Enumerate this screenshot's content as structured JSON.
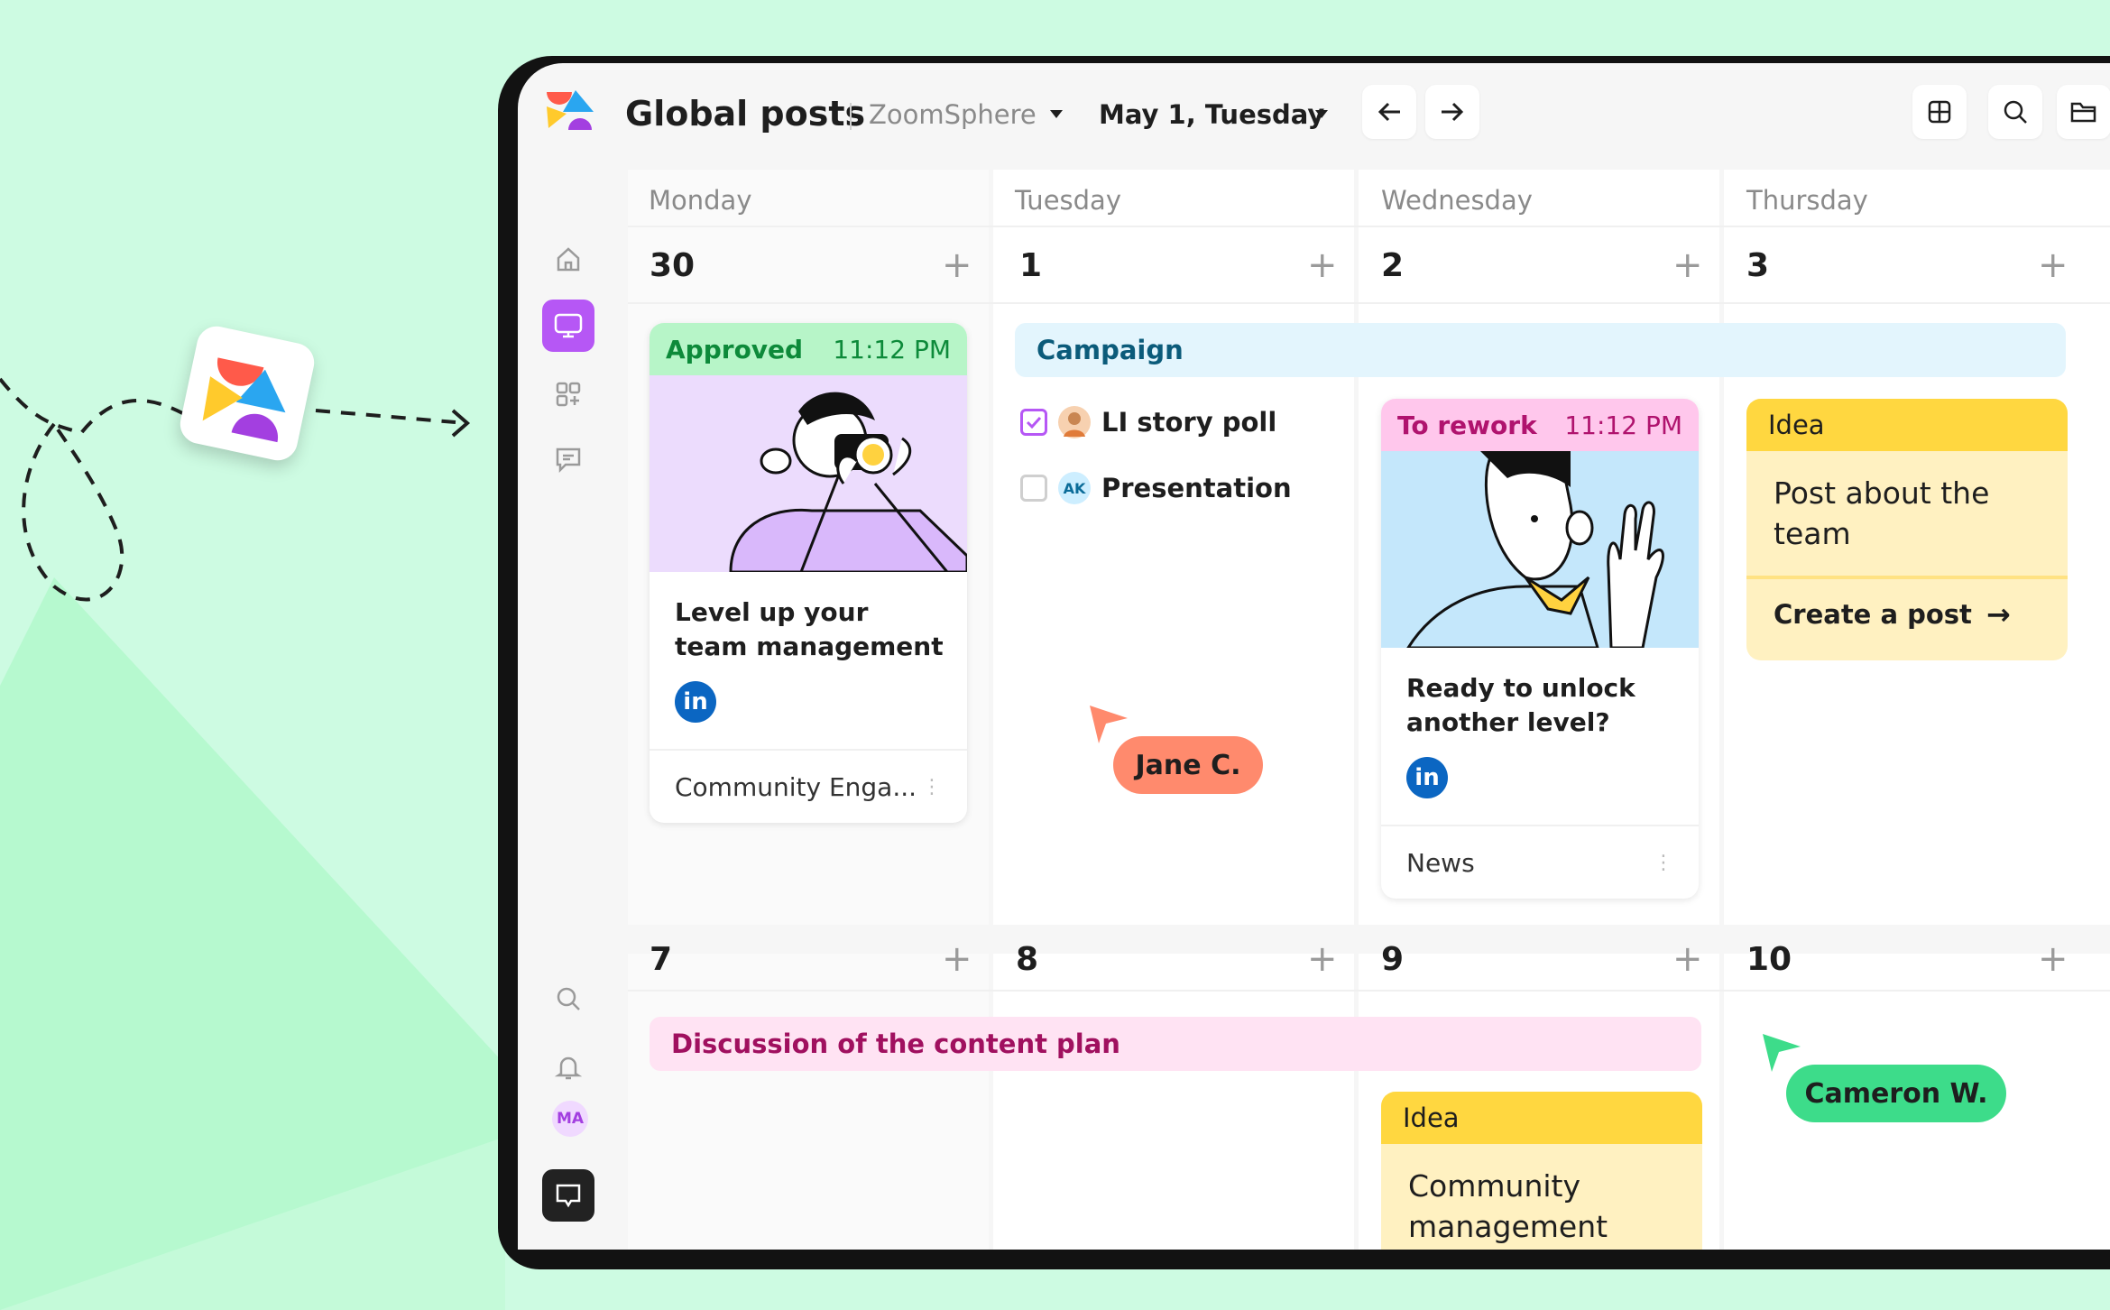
{
  "header": {
    "title": "Global posts",
    "workspace": "ZoomSphere",
    "date": "May 1, Tuesday"
  },
  "days": [
    "Monday",
    "Tuesday",
    "Wednesday",
    "Thursday"
  ],
  "week1": [
    "30",
    "1",
    "2",
    "3"
  ],
  "week2": [
    "7",
    "8",
    "9",
    "10"
  ],
  "campaign": "Campaign",
  "discussion": "Discussion of the content plan",
  "card1": {
    "status": "Approved",
    "time": "11:12 PM",
    "text": "Level up your team management",
    "network": "in",
    "category": "Community Enga...",
    "more": "⋮"
  },
  "tasks": [
    {
      "label": "LI story poll",
      "checked": true
    },
    {
      "label": "Presentation",
      "avatar": "AK",
      "checked": false
    }
  ],
  "card2": {
    "status": "To rework",
    "time": "11:12 PM",
    "text": "Ready to unlock another level?",
    "network": "in",
    "category": "News",
    "more": "⋮"
  },
  "idea1": {
    "label": "Idea",
    "text": "Post about the team",
    "action": "Create a post",
    "action_icon": "→"
  },
  "idea2": {
    "label": "Idea",
    "text": "Community management"
  },
  "cursors": {
    "jane": "Jane C.",
    "cameron": "Cameron W."
  },
  "sidebar": {
    "avatar": "MA",
    "active_color": "#b657f5"
  },
  "colors": {
    "approved_head": "#b7f5c8",
    "approved_text": "#0d8a3a",
    "rework_head": "#ffc7ec",
    "rework_text": "#b0136e",
    "campaign_bg": "#e3f5fd",
    "campaign_text": "#0b5b7a",
    "discussion_bg": "#ffe3f3",
    "discussion_text": "#a0105f",
    "jane": "#ff8a6d",
    "cameron": "#3ddc8a"
  }
}
